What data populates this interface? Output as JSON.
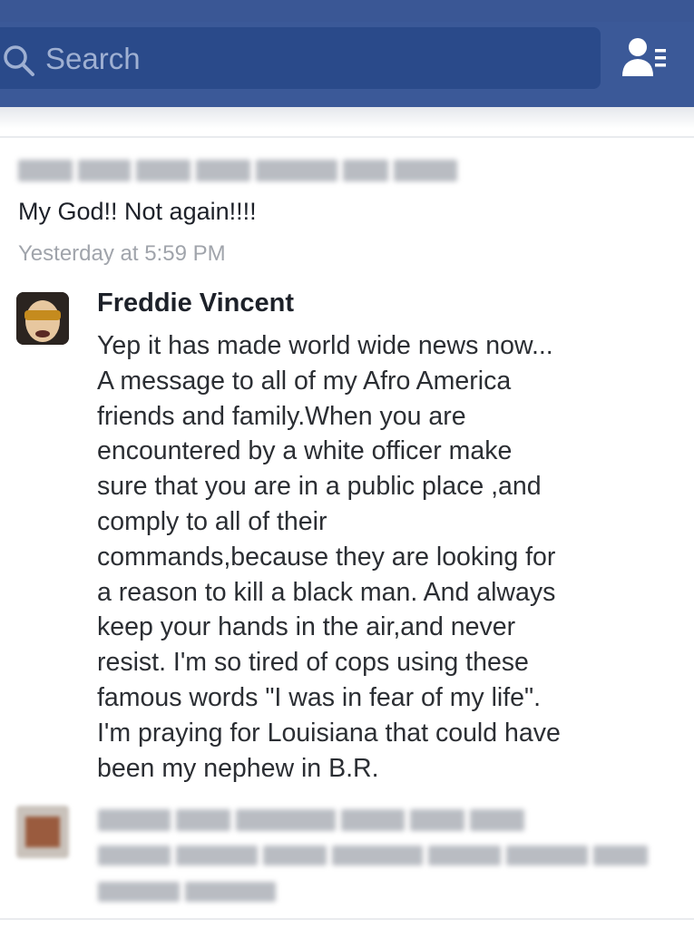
{
  "search": {
    "placeholder": "Search"
  },
  "icons": {
    "search": "search-icon",
    "friends": "friend-requests-icon"
  },
  "colors": {
    "brand": "#3b5998",
    "text": "#1d2129",
    "muted": "#a0a4ab"
  },
  "comment": {
    "text": "My God!! Not again!!!!",
    "timestamp": "Yesterday at 5:59 PM"
  },
  "reply": {
    "author": "Freddie Vincent",
    "lines": [
      "Yep it has made world wide news now...",
      "A message to all of my Afro America",
      "friends and family.When you are",
      "encountered by a white officer make",
      "sure that you are in a public place ,and",
      "comply to all of their",
      "commands,because they are looking for",
      "a reason to kill a black man. And always",
      "keep your hands in the air,and never",
      "resist. I'm so tired of cops using these",
      "famous words \"I was in fear of my life\".",
      "I'm praying for Louisiana that could have",
      "been my nephew in B.R."
    ]
  }
}
